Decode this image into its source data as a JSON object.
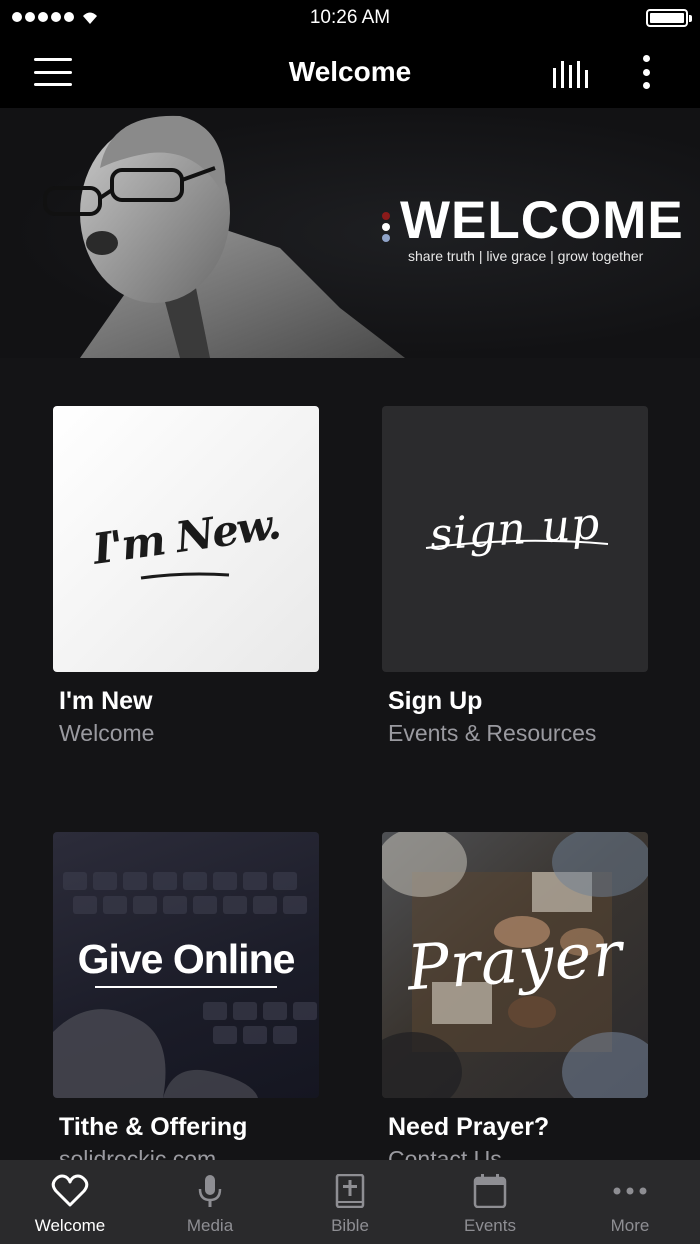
{
  "status_bar": {
    "time": "10:26 AM"
  },
  "nav": {
    "title": "Welcome"
  },
  "hero": {
    "heading": "WELCOME",
    "tagline": "share truth | live grace | grow together",
    "dot_colors": [
      "#8b1a1a",
      "#ffffff",
      "#8fa3c8"
    ]
  },
  "cards": [
    {
      "thumb_text": "I'm New.",
      "title": "I'm New",
      "subtitle": "Welcome"
    },
    {
      "thumb_text": "sign up",
      "title": "Sign Up",
      "subtitle": "Events & Resources"
    },
    {
      "thumb_text": "Give Online",
      "title": "Tithe & Offering",
      "subtitle": "solidrockic.com"
    },
    {
      "thumb_text": "Prayer",
      "title": "Need Prayer?",
      "subtitle": "Contact Us"
    }
  ],
  "tabs": [
    {
      "label": "Welcome",
      "icon": "heart-icon",
      "active": true
    },
    {
      "label": "Media",
      "icon": "microphone-icon",
      "active": false
    },
    {
      "label": "Bible",
      "icon": "bible-icon",
      "active": false
    },
    {
      "label": "Events",
      "icon": "calendar-icon",
      "active": false
    },
    {
      "label": "More",
      "icon": "ellipsis-icon",
      "active": false
    }
  ]
}
